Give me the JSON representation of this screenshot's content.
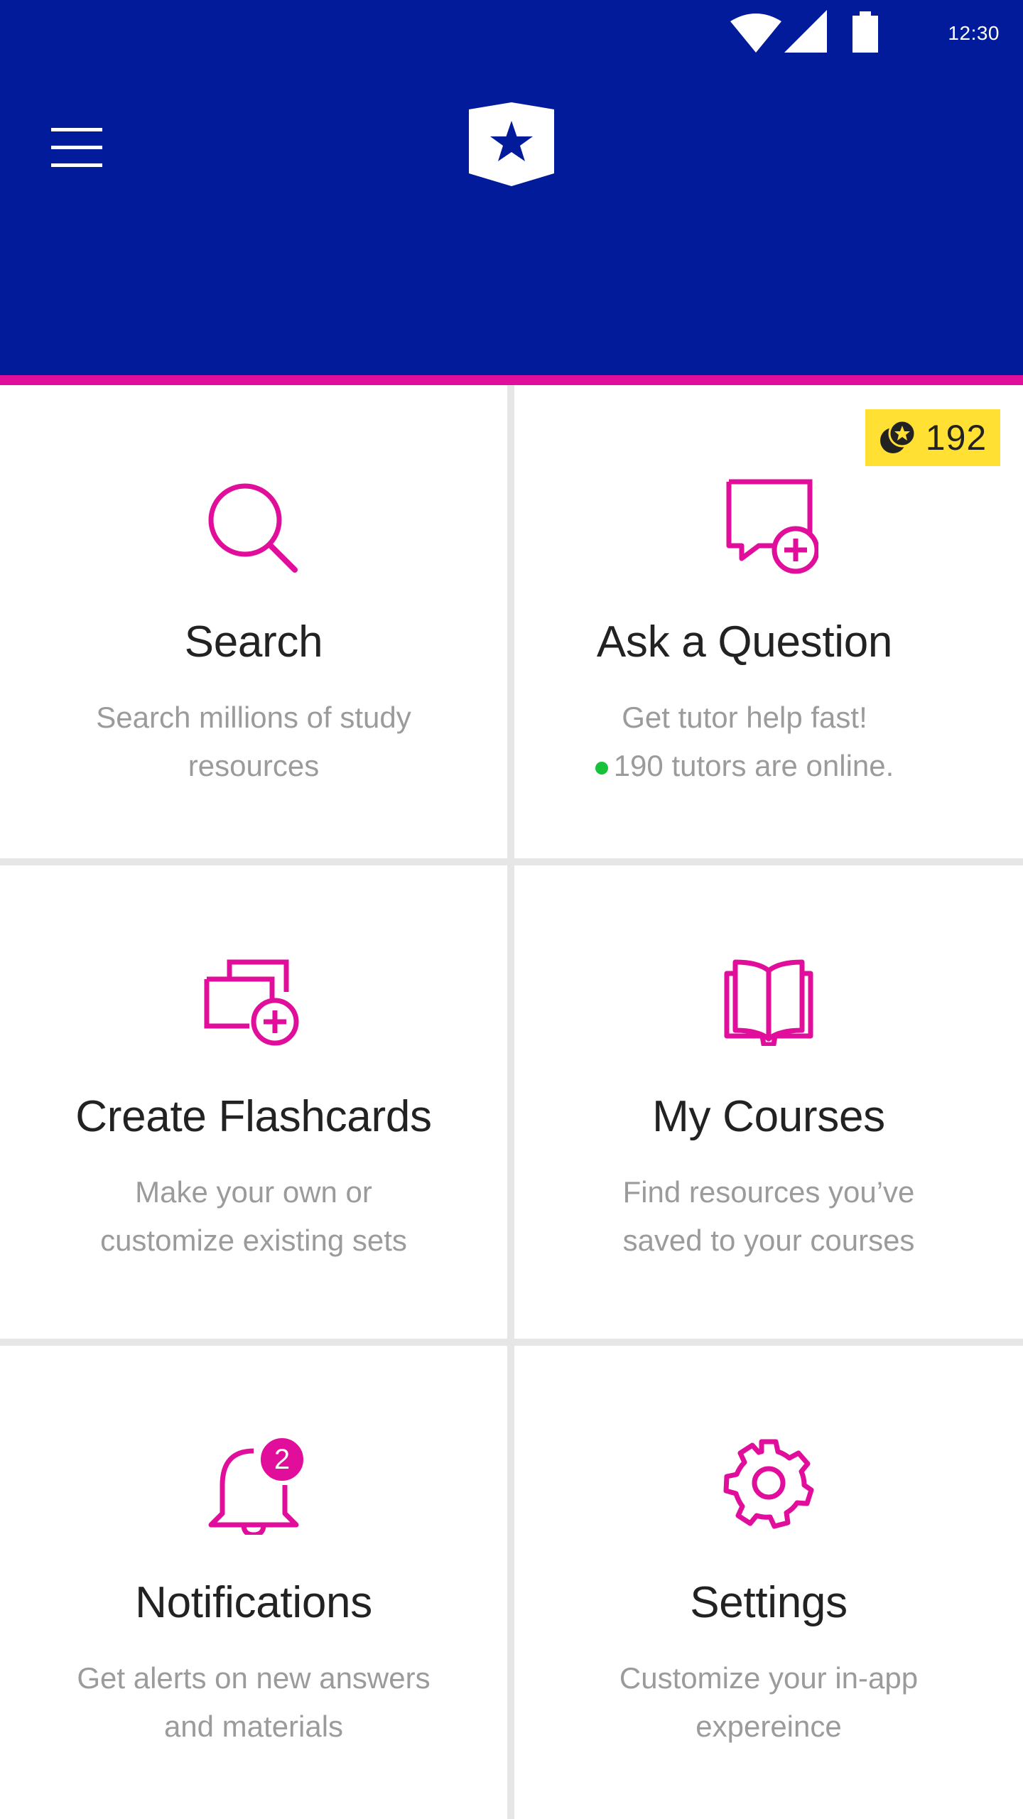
{
  "status_bar": {
    "time": "12:30",
    "icons": [
      "wifi-icon",
      "cellular-signal-icon",
      "battery-icon"
    ]
  },
  "header": {
    "menu_icon": "hamburger-menu-icon",
    "logo_icon": "shield-star-logo"
  },
  "colors": {
    "header_bg": "#021b9a",
    "accent": "#e00e9b",
    "badge_bg": "#ffe033",
    "online_dot": "#17c23a",
    "title_text": "#222222",
    "desc_text": "#9b9b9b"
  },
  "tiles": {
    "search": {
      "icon": "search-icon",
      "title": "Search",
      "desc_line1": "Search millions of study",
      "desc_line2": "resources"
    },
    "ask": {
      "icon": "chat-plus-icon",
      "title": "Ask a Question",
      "desc_line1": "Get tutor help fast!",
      "desc_line2": "190 tutors are online.",
      "points_icon": "coin-star-icon",
      "points": "192"
    },
    "flashcards": {
      "icon": "flashcards-plus-icon",
      "title": "Create Flashcards",
      "desc_line1": "Make your own or",
      "desc_line2": "customize existing sets"
    },
    "courses": {
      "icon": "open-book-icon",
      "title": "My Courses",
      "desc_line1": "Find resources you’ve",
      "desc_line2": "saved to your courses"
    },
    "notifications": {
      "icon": "bell-icon",
      "title": "Notifications",
      "count": "2",
      "desc_line1": "Get alerts on new answers",
      "desc_line2": "and materials"
    },
    "settings": {
      "icon": "gear-icon",
      "title": "Settings",
      "desc_line1": "Customize your in-app",
      "desc_line2": "expereince"
    }
  }
}
